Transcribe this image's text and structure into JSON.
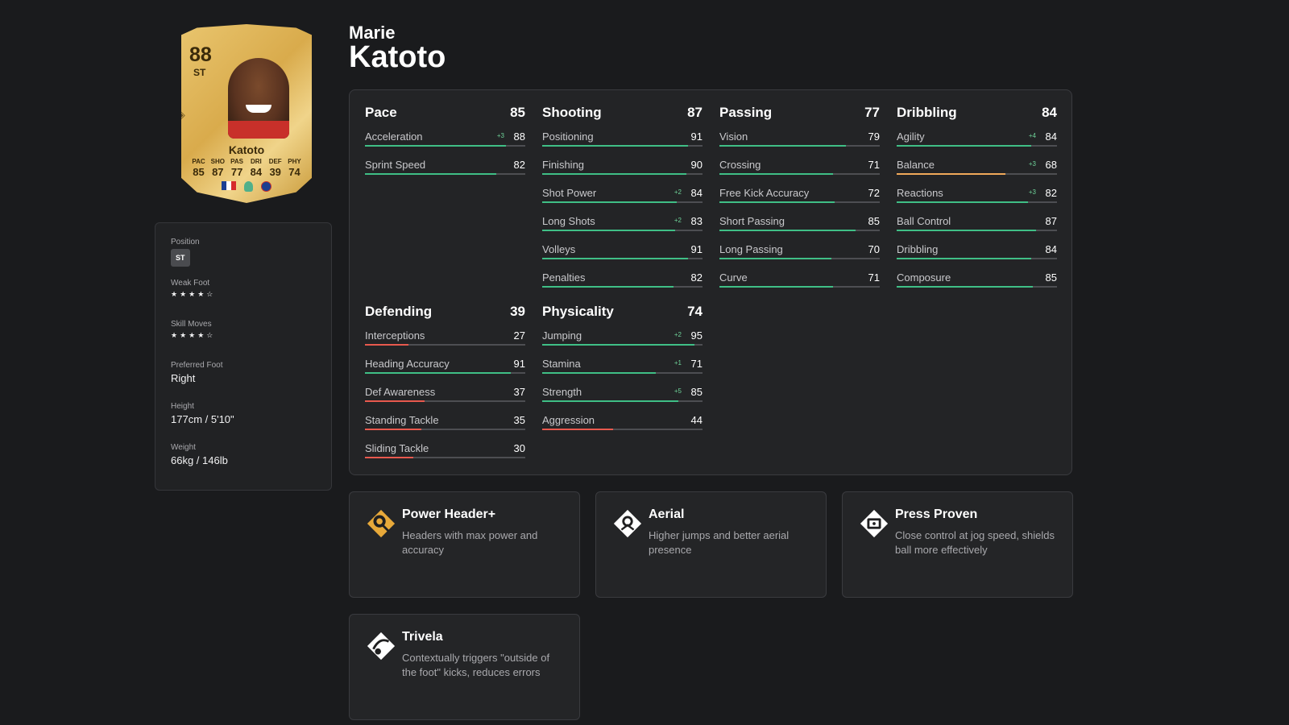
{
  "colors": {
    "bar_high": "#3fbf86",
    "bar_mid": "#f0a95a",
    "bar_low": "#e8594e"
  },
  "card": {
    "rating": "88",
    "position": "ST",
    "name": "Katoto",
    "stat_labels": [
      "PAC",
      "SHO",
      "PAS",
      "DRI",
      "DEF",
      "PHY"
    ],
    "stat_values": [
      "85",
      "87",
      "77",
      "84",
      "39",
      "74"
    ],
    "icons": [
      "edit-icon",
      "france-flag-icon",
      "league-icon",
      "club-badge-icon"
    ]
  },
  "info": {
    "position_label": "Position",
    "position_value": "ST",
    "weak_foot_label": "Weak Foot",
    "weak_foot_stars": 4,
    "weak_foot_display": "★★★★☆",
    "skill_moves_label": "Skill Moves",
    "skill_moves_stars": 4,
    "skill_moves_display": "★★★★☆",
    "preferred_foot_label": "Preferred Foot",
    "preferred_foot_value": "Right",
    "height_label": "Height",
    "height_value": "177cm / 5'10\"",
    "weight_label": "Weight",
    "weight_value": "66kg / 146lb"
  },
  "player": {
    "first_name": "Marie",
    "last_name": "Katoto"
  },
  "groups": [
    {
      "title": "Pace",
      "value": "85",
      "stats": [
        {
          "name": "Acceleration",
          "value": "88",
          "bonus": "+3"
        },
        {
          "name": "Sprint Speed",
          "value": "82",
          "bonus": ""
        }
      ]
    },
    {
      "title": "Shooting",
      "value": "87",
      "stats": [
        {
          "name": "Positioning",
          "value": "91",
          "bonus": ""
        },
        {
          "name": "Finishing",
          "value": "90",
          "bonus": ""
        },
        {
          "name": "Shot Power",
          "value": "84",
          "bonus": "+2"
        },
        {
          "name": "Long Shots",
          "value": "83",
          "bonus": "+2"
        },
        {
          "name": "Volleys",
          "value": "91",
          "bonus": ""
        },
        {
          "name": "Penalties",
          "value": "82",
          "bonus": ""
        }
      ]
    },
    {
      "title": "Passing",
      "value": "77",
      "stats": [
        {
          "name": "Vision",
          "value": "79",
          "bonus": ""
        },
        {
          "name": "Crossing",
          "value": "71",
          "bonus": ""
        },
        {
          "name": "Free Kick Accuracy",
          "value": "72",
          "bonus": ""
        },
        {
          "name": "Short Passing",
          "value": "85",
          "bonus": ""
        },
        {
          "name": "Long Passing",
          "value": "70",
          "bonus": ""
        },
        {
          "name": "Curve",
          "value": "71",
          "bonus": ""
        }
      ]
    },
    {
      "title": "Dribbling",
      "value": "84",
      "stats": [
        {
          "name": "Agility",
          "value": "84",
          "bonus": "+4"
        },
        {
          "name": "Balance",
          "value": "68",
          "bonus": "+3"
        },
        {
          "name": "Reactions",
          "value": "82",
          "bonus": "+3"
        },
        {
          "name": "Ball Control",
          "value": "87",
          "bonus": ""
        },
        {
          "name": "Dribbling",
          "value": "84",
          "bonus": ""
        },
        {
          "name": "Composure",
          "value": "85",
          "bonus": ""
        }
      ]
    },
    {
      "title": "Defending",
      "value": "39",
      "stats": [
        {
          "name": "Interceptions",
          "value": "27",
          "bonus": ""
        },
        {
          "name": "Heading Accuracy",
          "value": "91",
          "bonus": ""
        },
        {
          "name": "Def Awareness",
          "value": "37",
          "bonus": ""
        },
        {
          "name": "Standing Tackle",
          "value": "35",
          "bonus": ""
        },
        {
          "name": "Sliding Tackle",
          "value": "30",
          "bonus": ""
        }
      ]
    },
    {
      "title": "Physicality",
      "value": "74",
      "stats": [
        {
          "name": "Jumping",
          "value": "95",
          "bonus": "+2"
        },
        {
          "name": "Stamina",
          "value": "71",
          "bonus": "+1"
        },
        {
          "name": "Strength",
          "value": "85",
          "bonus": "+5"
        },
        {
          "name": "Aggression",
          "value": "44",
          "bonus": ""
        }
      ]
    }
  ],
  "playstyles": [
    {
      "icon": "power-header-icon",
      "title": "Power Header+",
      "desc": "Headers with max power and accuracy"
    },
    {
      "icon": "aerial-icon",
      "title": "Aerial",
      "desc": "Higher jumps and better aerial presence"
    },
    {
      "icon": "press-proven-icon",
      "title": "Press Proven",
      "desc": "Close control at jog speed, shields ball more effectively"
    },
    {
      "icon": "trivela-icon",
      "title": "Trivela",
      "desc": "Contextually triggers \"outside of the foot\" kicks, reduces errors"
    }
  ]
}
